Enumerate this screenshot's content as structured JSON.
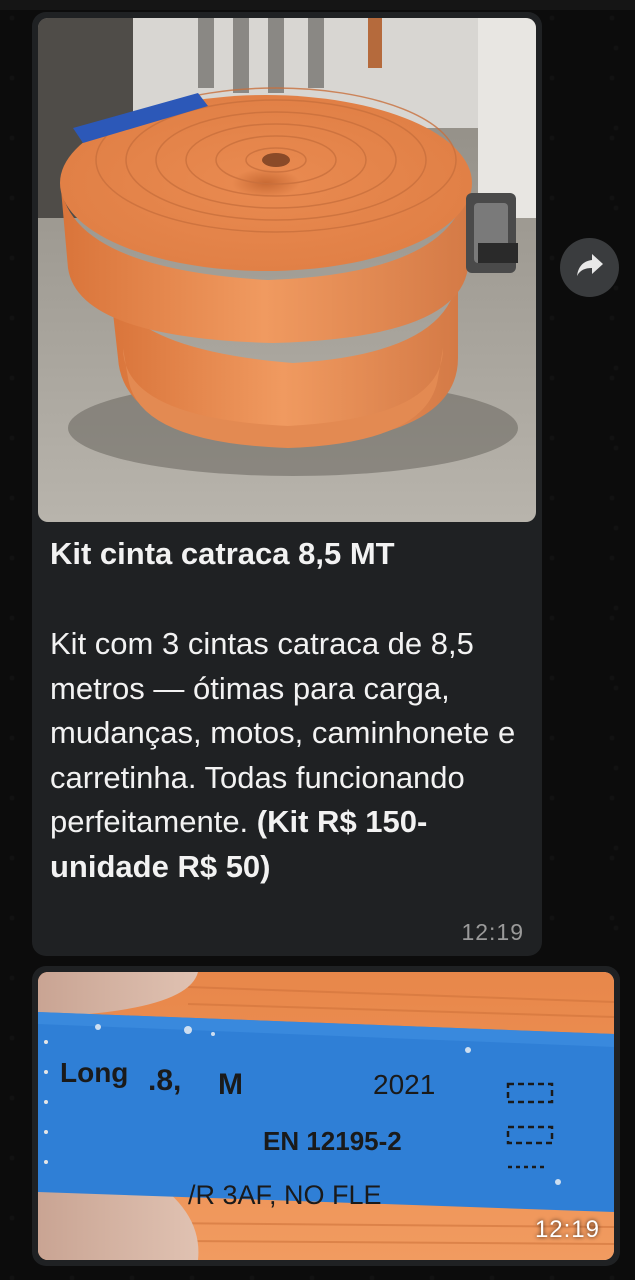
{
  "message_1": {
    "image_alt": "orange ratchet strap roll",
    "caption_title": "Kit cinta catraca 8,5 MT",
    "caption_body": "Kit com 3 cintas catraca de 8,5 metros — ótimas para carga, mudanças, motos, caminhonete e carretinha. Todas funcionando perfeitamente. ",
    "caption_price": "(Kit R$ 150- unidade R$ 50)",
    "time": "12:19"
  },
  "forward_button": {
    "icon": "forward-arrow-icon"
  },
  "message_2": {
    "image_alt": "strap label close-up",
    "label_text": {
      "line1_left": "Long",
      "line1_mid": ".8,",
      "line1_unit": "M",
      "line1_year": "2021",
      "line2": "EN 12195-2",
      "line3": "/R 3AF, NO FLE"
    },
    "time": "12:19"
  },
  "colors": {
    "bubble_bg": "#1f2123",
    "strap_orange": "#e98a4c",
    "label_blue": "#2f7fd6",
    "text_primary": "#f2f2f2",
    "timestamp": "#9a9a9a"
  }
}
